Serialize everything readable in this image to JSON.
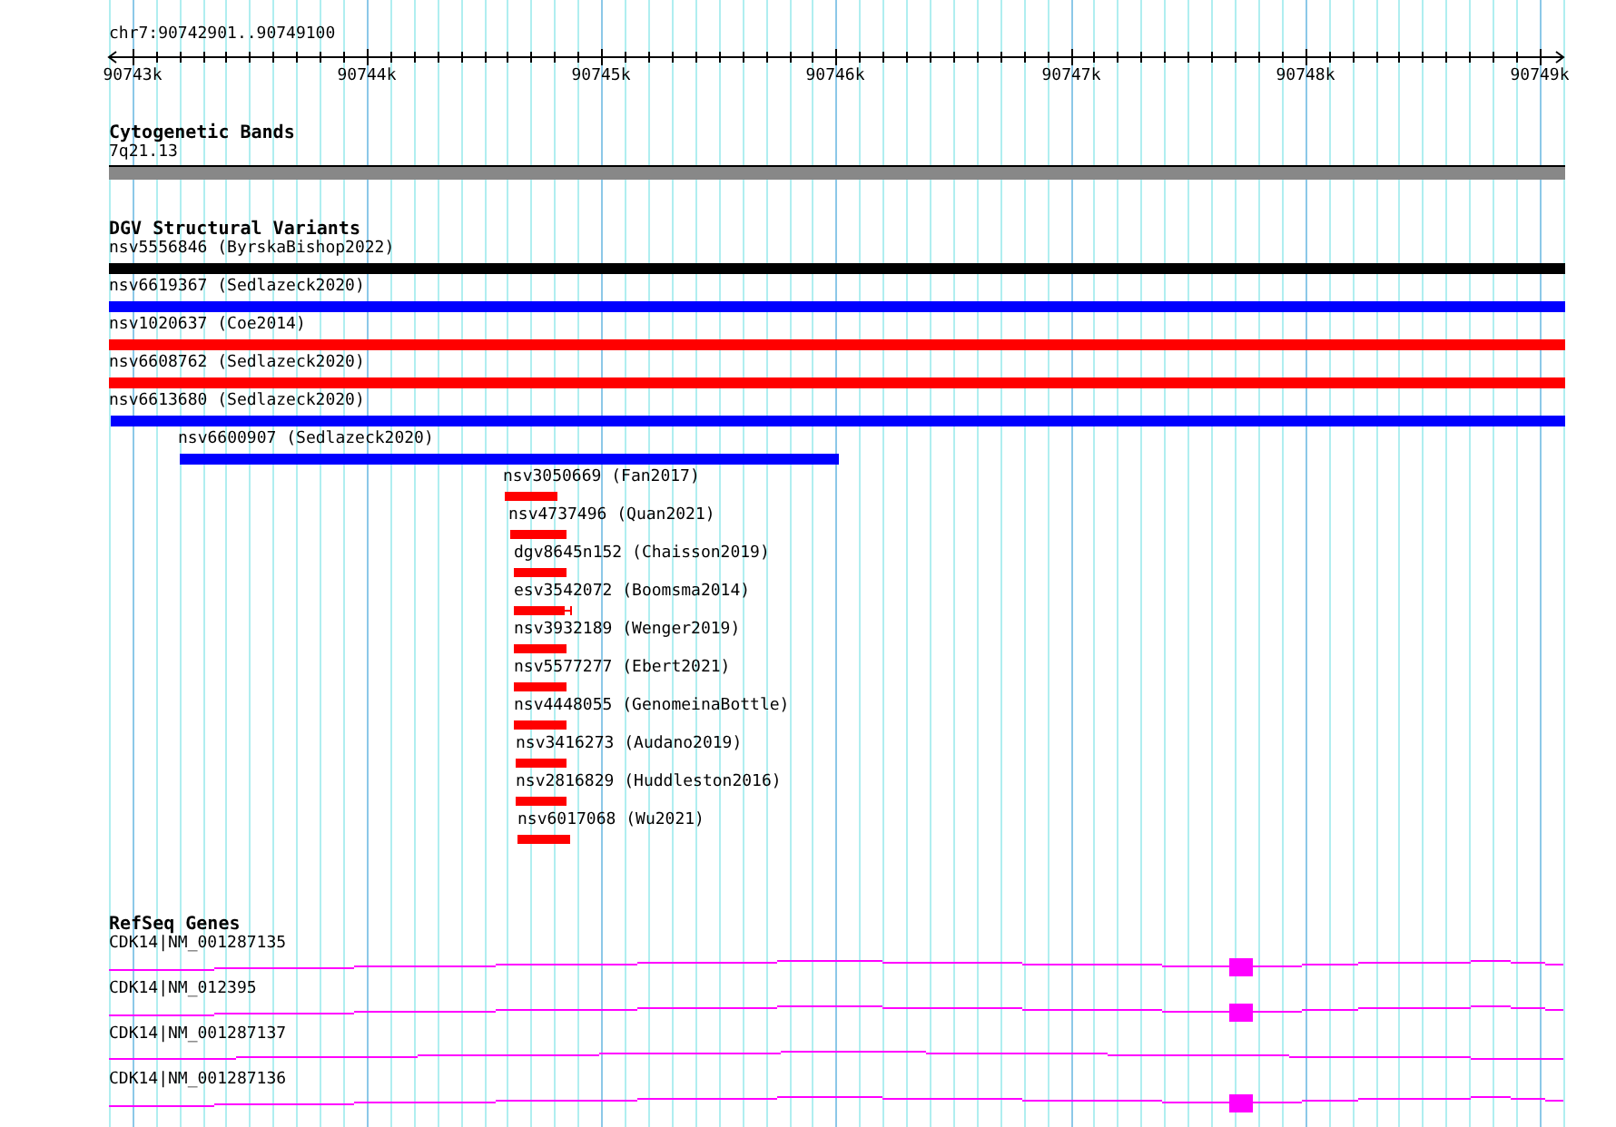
{
  "ruler": {
    "region": "chr7:90742901..90749100",
    "ticks": [
      "90743k",
      "90744k",
      "90745k",
      "90746k",
      "90747k",
      "90748k",
      "90749k"
    ]
  },
  "tracks": [
    {
      "kind": "band",
      "title": "Cytogenetic Bands",
      "features": [
        {
          "label": "7q21.13"
        }
      ]
    },
    {
      "kind": "variant",
      "title": "DGV Structural Variants",
      "features": [
        {
          "label": "nsv5556846 (ByrskaBishop2022)",
          "color": "#000000"
        },
        {
          "label": "nsv6619367 (Sedlazeck2020)",
          "color": "#0000ff"
        },
        {
          "label": "nsv1020637 (Coe2014)",
          "color": "#ff0000"
        },
        {
          "label": "nsv6608762 (Sedlazeck2020)",
          "color": "#ff0000"
        },
        {
          "label": "nsv6613680 (Sedlazeck2020)",
          "color": "#0000ff"
        },
        {
          "label": "nsv6600907 (Sedlazeck2020)",
          "color": "#0000ff"
        },
        {
          "label": "nsv3050669 (Fan2017)",
          "color": "#ff0000"
        },
        {
          "label": "nsv4737496 (Quan2021)",
          "color": "#ff0000"
        },
        {
          "label": "dgv8645n152 (Chaisson2019)",
          "color": "#ff0000"
        },
        {
          "label": "esv3542072 (Boomsma2014)",
          "color": "#ff0000"
        },
        {
          "label": "nsv3932189 (Wenger2019)",
          "color": "#ff0000"
        },
        {
          "label": "nsv5577277 (Ebert2021)",
          "color": "#ff0000"
        },
        {
          "label": "nsv4448055 (GenomeinaBottle)",
          "color": "#ff0000"
        },
        {
          "label": "nsv3416273 (Audano2019)",
          "color": "#ff0000"
        },
        {
          "label": "nsv2816829 (Huddleston2016)",
          "color": "#ff0000"
        },
        {
          "label": "nsv6017068 (Wu2021)",
          "color": "#ff0000"
        }
      ]
    },
    {
      "kind": "gene",
      "title": "RefSeq Genes",
      "features": [
        {
          "label": "CDK14|NM_001287135"
        },
        {
          "label": "CDK14|NM_012395"
        },
        {
          "label": "CDK14|NM_001287137"
        },
        {
          "label": "CDK14|NM_001287136"
        }
      ]
    }
  ]
}
